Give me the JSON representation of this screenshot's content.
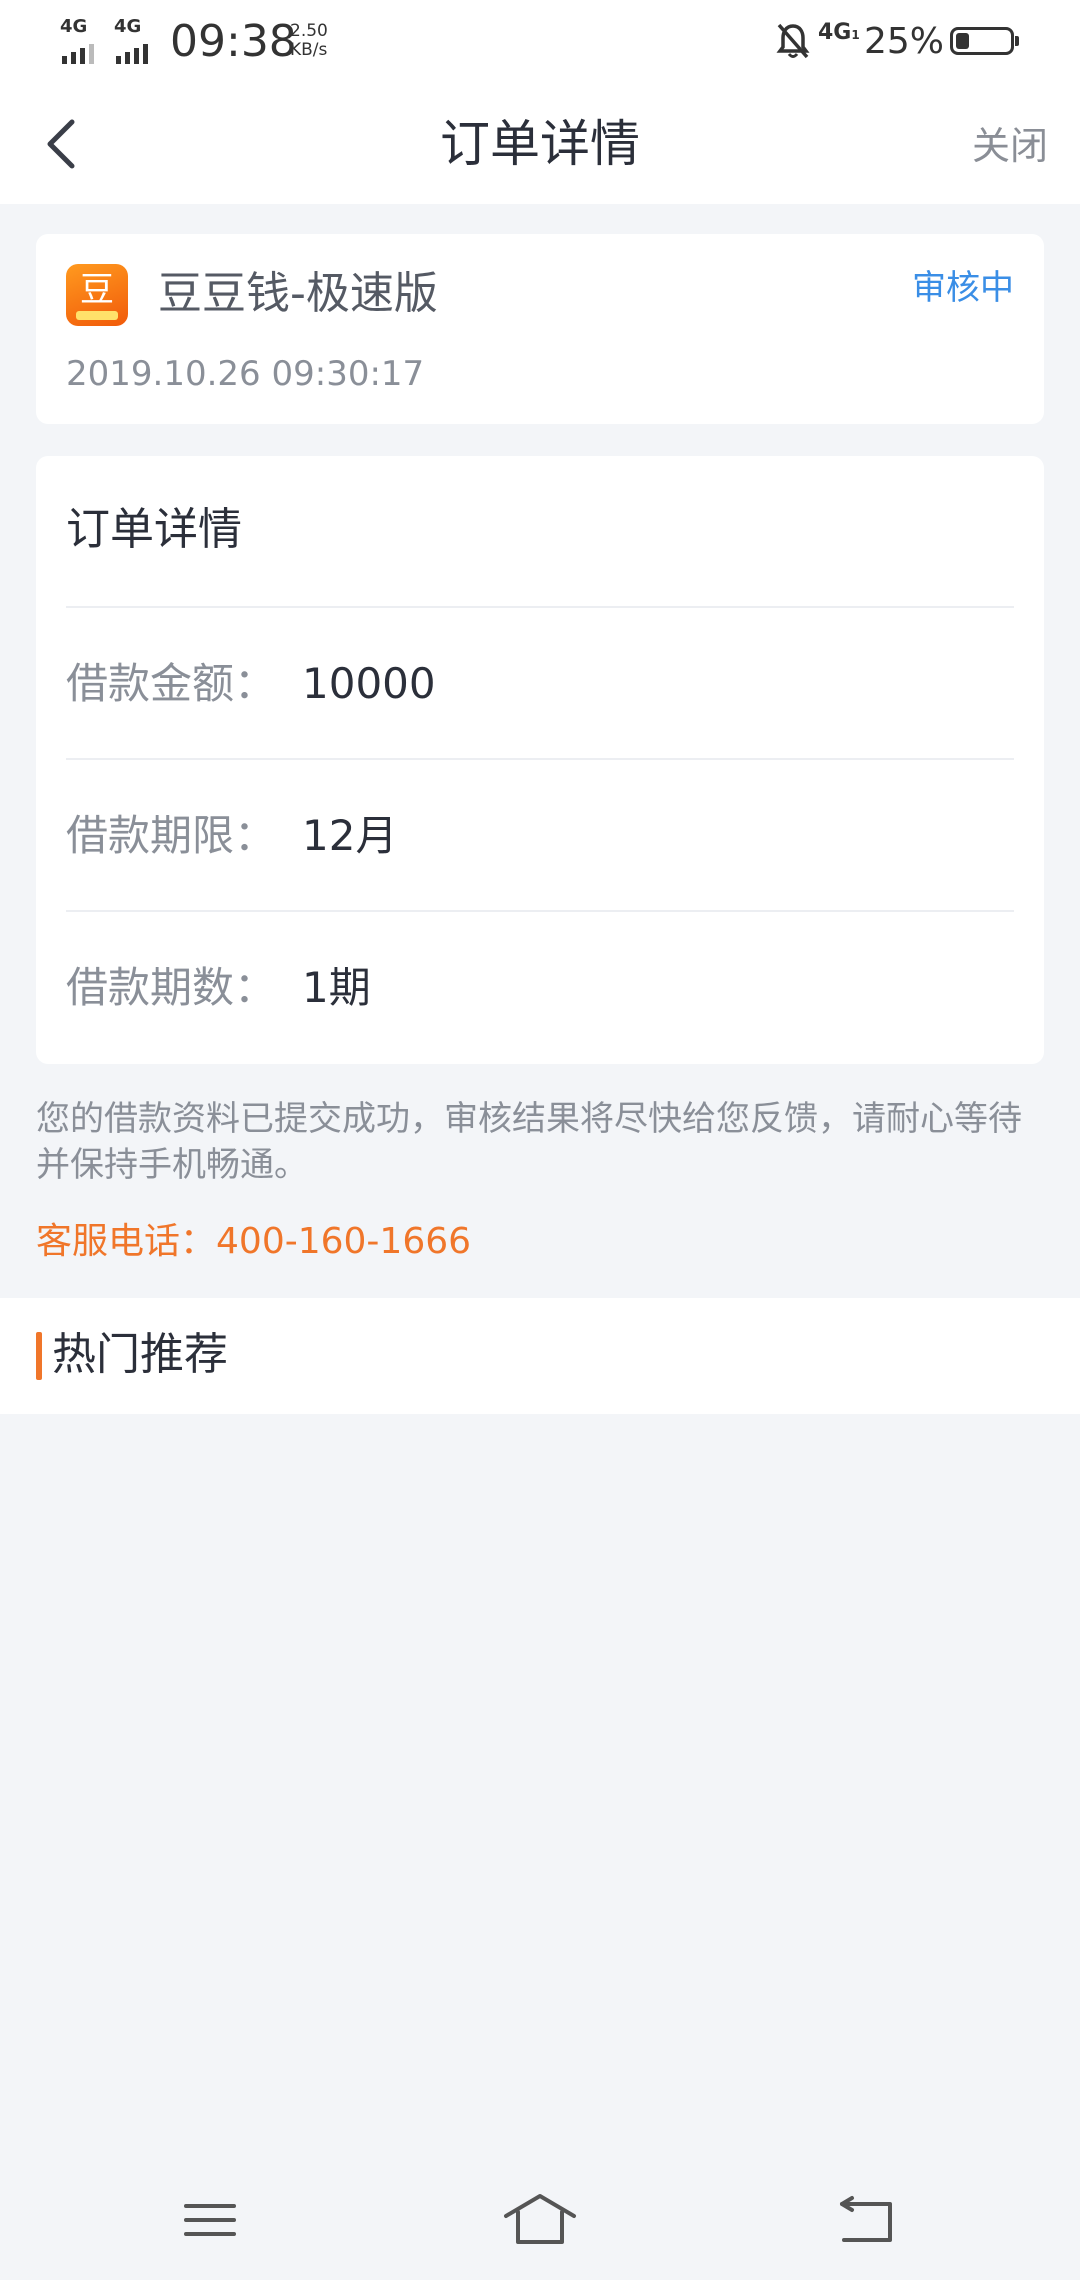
{
  "status_bar": {
    "sim1": "4G",
    "sim2": "4G",
    "time": "09:38",
    "speed_value": "2.50",
    "speed_unit": "KB/s",
    "network": "4G",
    "network_sub": "1",
    "battery_pct": "25%",
    "battery_level": 0.25,
    "icons": [
      "signal-icon",
      "mute-bell-icon",
      "battery-icon"
    ]
  },
  "nav": {
    "back_icon": "chevron-left-icon",
    "title": "订单详情",
    "close_label": "关闭"
  },
  "app_card": {
    "logo_glyph": "豆",
    "name": "豆豆钱-极速版",
    "status": "审核中",
    "status_color": "#3a8ee6",
    "timestamp": "2019.10.26 09:30:17"
  },
  "detail_card": {
    "title": "订单详情",
    "rows": [
      {
        "label": "借款金额：",
        "value": "10000"
      },
      {
        "label": "借款期限：",
        "value": "12月"
      },
      {
        "label": "借款期数：",
        "value": "1期"
      }
    ]
  },
  "notice": {
    "text": "您的借款资料已提交成功，审核结果将尽快给您反馈，请耐心等待并保持手机畅通。",
    "service_label": "客服电话：",
    "service_phone": "400-160-1666",
    "accent_color": "#f0762a"
  },
  "hot": {
    "title": "热门推荐"
  },
  "system_nav": {
    "icons": [
      "menu-icon",
      "home-icon",
      "back-icon"
    ]
  }
}
